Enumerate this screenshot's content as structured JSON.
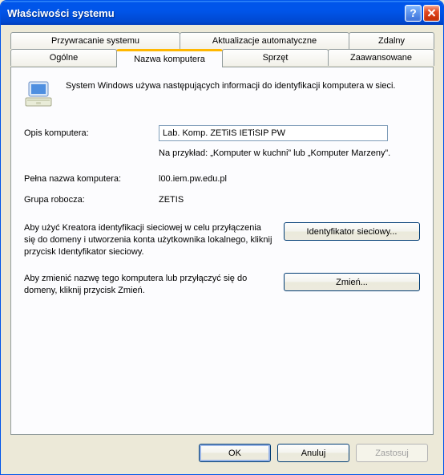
{
  "window": {
    "title": "Właściwości systemu"
  },
  "tabs": {
    "row1": [
      "Przywracanie systemu",
      "Aktualizacje automatyczne",
      "Zdalny"
    ],
    "row2": [
      "Ogólne",
      "Nazwa komputera",
      "Sprzęt",
      "Zaawansowane"
    ],
    "active": "Nazwa komputera"
  },
  "pane": {
    "intro": "System Windows używa następujących informacji do identyfikacji komputera w sieci.",
    "desc_label": "Opis komputera:",
    "desc_value": "Lab. Komp. ZETiIS IETiSIP PW",
    "desc_hint": "Na przykład: „Komputer w kuchni” lub „Komputer Marzeny”.",
    "fullname_label": "Pełna nazwa komputera:",
    "fullname_value": "l00.iem.pw.edu.pl",
    "workgroup_label": "Grupa robocza:",
    "workgroup_value": "ZETIS",
    "wizard_text": "Aby użyć Kreatora identyfikacji sieciowej w celu przyłączenia się do domeny i utworzenia konta użytkownika lokalnego, kliknij przycisk Identyfikator sieciowy.",
    "wizard_btn": "Identyfikator sieciowy...",
    "change_text": "Aby zmienić nazwę tego komputera lub przyłączyć się do domeny, kliknij przycisk Zmień.",
    "change_btn": "Zmień..."
  },
  "buttons": {
    "ok": "OK",
    "cancel": "Anuluj",
    "apply": "Zastosuj"
  }
}
